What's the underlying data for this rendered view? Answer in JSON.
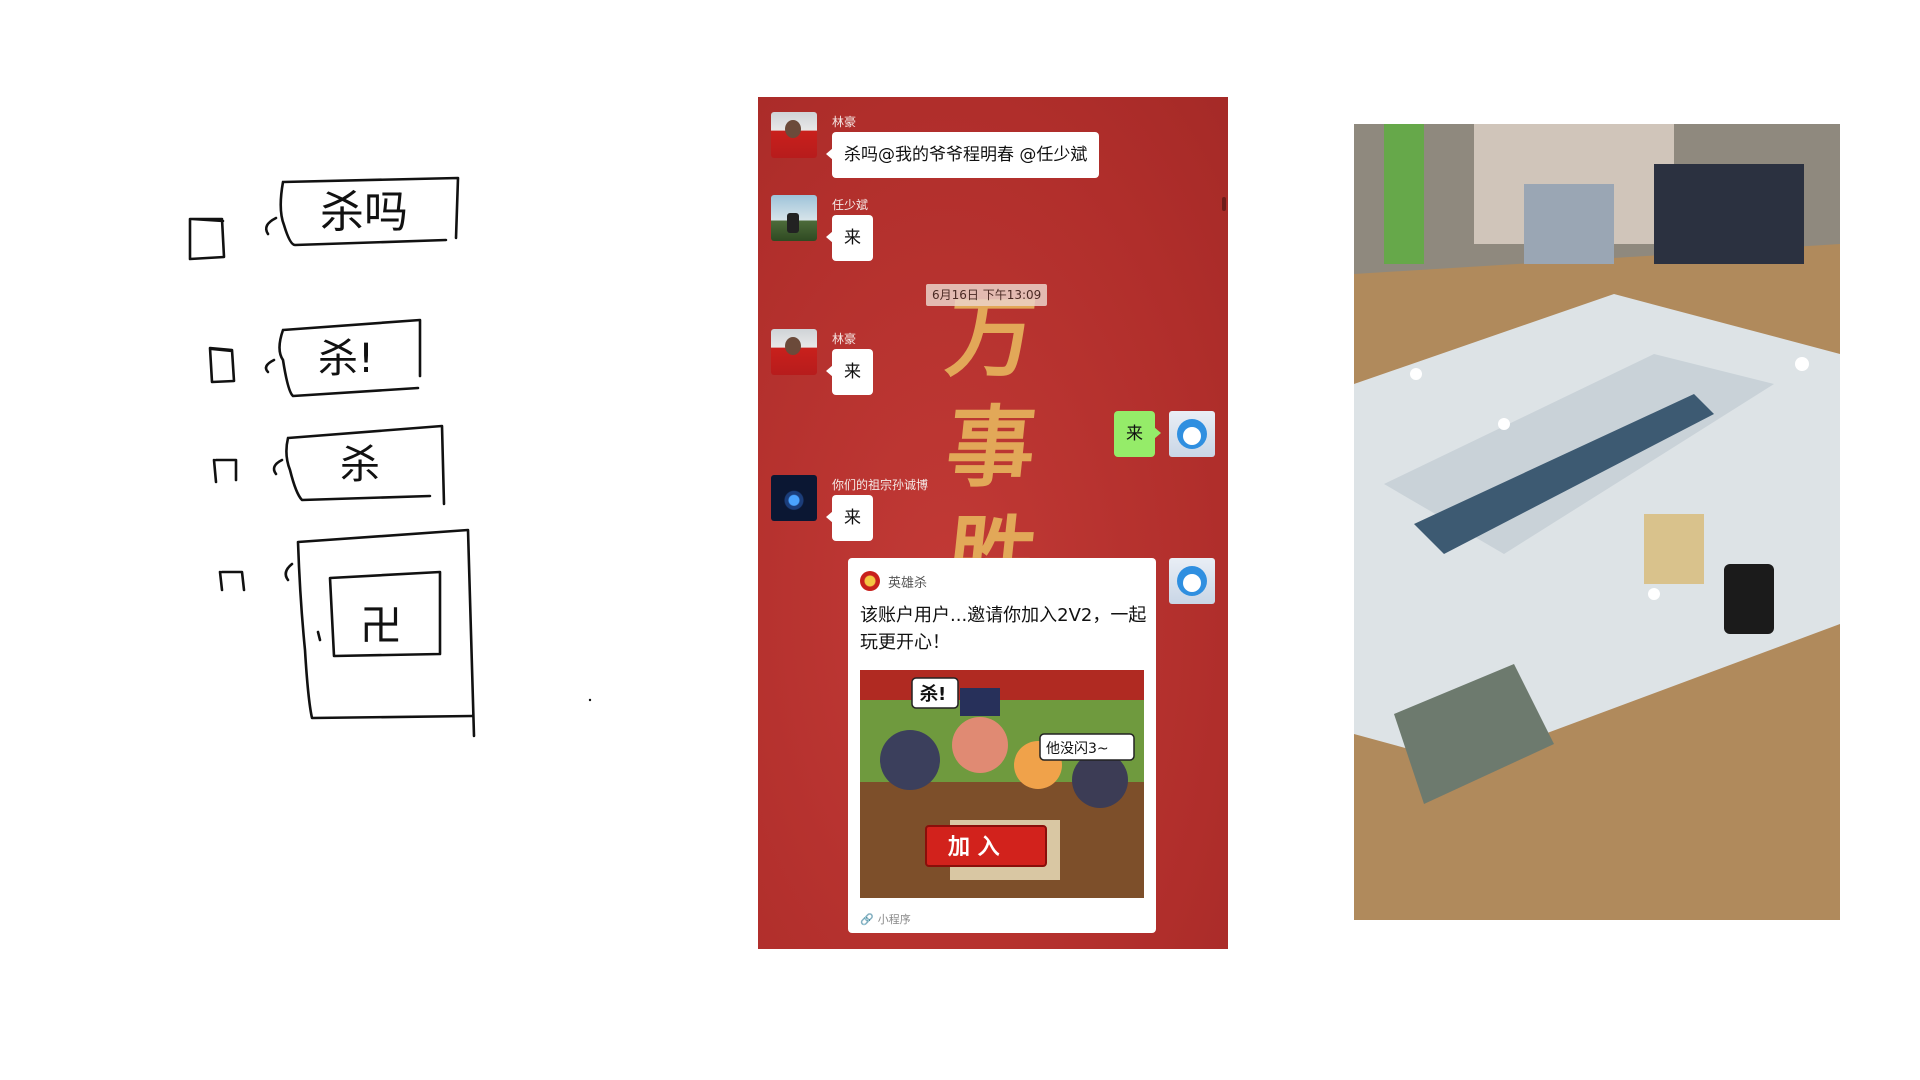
{
  "sketch": {
    "bubbles": [
      "杀吗",
      "杀!",
      "杀"
    ],
    "glyph": "卍"
  },
  "chat": {
    "background_text": [
      "万",
      "事",
      "胜"
    ],
    "timestamp": "6月16日 下午13:09",
    "messages": [
      {
        "sender": "林豪",
        "text": "杀吗@我的爷爷程明春 @任少斌"
      },
      {
        "sender": "任少斌",
        "text": "来"
      },
      {
        "sender": "林豪",
        "text": "来"
      },
      {
        "sender": "me",
        "text": "来"
      },
      {
        "sender": "你们的祖宗孙诚博",
        "text": "来"
      }
    ],
    "mini_program_card": {
      "app_name": "英雄杀",
      "title": "该账户用户...邀请你加入2V2，一起玩更开心！",
      "image_texts": {
        "speech_left": "杀!",
        "speech_right": "他没闪3~",
        "join_button": "加 入"
      },
      "footer_label": "小程序"
    }
  },
  "photo": {
    "description_icon": "board-game-photo"
  },
  "colors": {
    "chat_bg": "#b9322f",
    "my_bubble": "#95ec69",
    "calligraphy": "#e6b25c"
  }
}
